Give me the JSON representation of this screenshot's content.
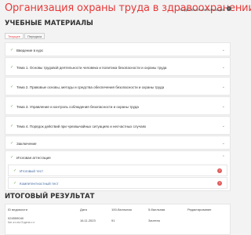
{
  "header": {
    "title": "Организация охраны труда в здравоохранении",
    "more_info": "ПОДРОБНАЯ ИНФОРМАЦИЯ"
  },
  "materials": {
    "heading": "УЧЕБНЫЕ МАТЕРИАЛЫ",
    "tabs": [
      "Текущее",
      "Передача"
    ],
    "items": [
      "Введение в курс",
      "Тема 1. Основы трудовой деятельности человека и политика безопасности и охраны труда",
      "Тема 2. Правовые основы, методы и средства обеспечения безопасности и охраны труда",
      "Тема 3. Управление и контроль соблюдения безопасности и охраны труда",
      "Тема 4. Порядок действий при чрезвычайных ситуациях и несчастных случаях",
      "Заключение",
      "Итоговая аттестация"
    ],
    "sub_items": [
      "Итоговый тест",
      "Компетентностный тест"
    ]
  },
  "results": {
    "heading": "ИТОГОВЫЙ РЕЗУЛЬТАТ",
    "columns": [
      "ID ведомости",
      "Дата",
      "100-балльная",
      "5-балльная",
      "Редактирование"
    ],
    "row": {
      "id": "024559040",
      "sub": "Кит-кт-лм Отдела с л",
      "date": "16.11.2023",
      "score100": "91",
      "score5": "Зачтено"
    }
  }
}
